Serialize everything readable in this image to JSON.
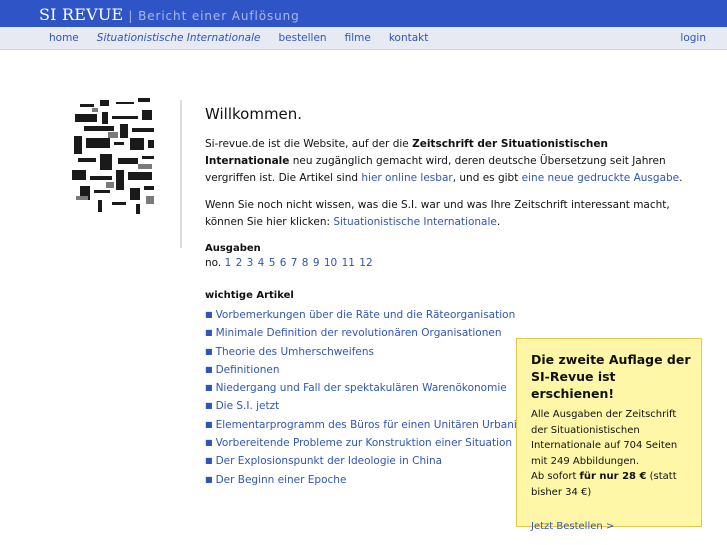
{
  "header": {
    "title": "SI REVUE",
    "subtitle": "| Bericht einer Auflösung",
    "nav": [
      {
        "label": "home",
        "italic": false
      },
      {
        "label": "Situationistische Internationale",
        "italic": true
      },
      {
        "label": "bestellen",
        "italic": false
      },
      {
        "label": "filme",
        "italic": false
      },
      {
        "label": "kontakt",
        "italic": false
      }
    ],
    "login": "login"
  },
  "main": {
    "welcome": "Willkommen.",
    "intro": {
      "t1": "Si-revue.de ist die Website, auf der die ",
      "b1": "Zeitschrift der Situationistischen Internationale",
      "t2": " neu zugänglich gemacht wird, deren deutsche Übersetzung seit Jahren vergriffen ist. Die Artikel sind ",
      "link1": "hier online lesbar",
      "t3": ", und es gibt ",
      "link2": "eine neue gedruckte Ausgabe",
      "t4": "."
    },
    "second": {
      "t1": "Wenn Sie noch nicht wissen, was die S.I. war und was Ihre Zeitschrift interessant macht, können Sie hier klicken: ",
      "link": "Situationistische Internationale",
      "t2": "."
    },
    "issues_title": "Ausgaben",
    "issues_prefix": "no.",
    "issues": [
      "1",
      "2",
      "3",
      "4",
      "5",
      "6",
      "7",
      "8",
      "9",
      "10",
      "11",
      "12"
    ],
    "articles_title": "wichtige Artikel",
    "articles": [
      "Vorbemerkungen über die Räte und die Räteorganisation",
      "Minimale Definition der revolutionären Organisationen",
      "Theorie des Umherschweifens",
      "Definitionen",
      "Niedergang und Fall der spektakulären Warenökonomie",
      "Die S.I. jetzt",
      "Elementarprogramm des Büros für einen Unitären Urbanismus",
      "Vorbereitende Probleme zur Konstruktion einer Situation",
      "Der Explosionspunkt der Ideologie in China",
      "Der Beginn einer Epoche"
    ]
  },
  "promo": {
    "title": "Die zweite Auflage der SI-Revue ist erschienen!",
    "body": "Alle Ausgaben der Zeitschrift der Situationistischen Internationale auf 704 Seiten mit 249 Abbildungen.",
    "offer_pre": "Ab sofort ",
    "offer_bold": "für nur 28 €",
    "offer_post": " (statt bisher 34 €)",
    "link": "Jetzt Bestellen >"
  },
  "colors": {
    "header_bg": "#2f54c6",
    "nav_bg": "#e7eaf2",
    "link": "#2f55b8",
    "promo_bg": "#fff7a8"
  }
}
